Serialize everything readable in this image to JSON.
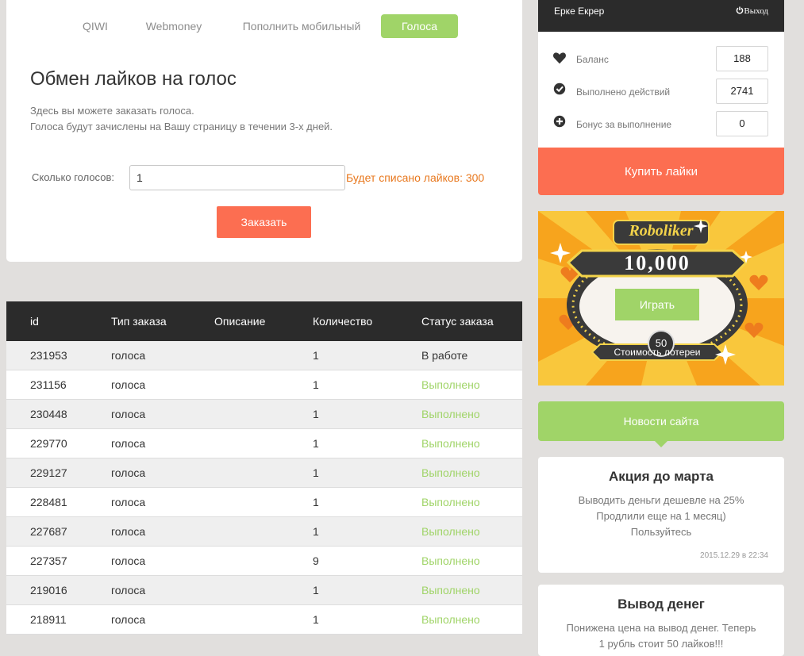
{
  "tabs": [
    {
      "label": "QIWI",
      "active": false
    },
    {
      "label": "Webmoney",
      "active": false
    },
    {
      "label": "Пополнить мобильный",
      "active": false
    },
    {
      "label": "Голоса",
      "active": true
    }
  ],
  "page": {
    "title": "Обмен лайков на голос",
    "desc_line1": "Здесь вы можете заказать голоса.",
    "desc_line2": "Голоса будут зачислены на Вашу страницу в течении 3-х дней."
  },
  "form": {
    "label": "Сколько голосов:",
    "value": "1",
    "cost_note": "Будет списано лайков: 300",
    "submit": "Заказать"
  },
  "table": {
    "headers": [
      "id",
      "Тип заказа",
      "Описание",
      "Количество",
      "Статус заказа"
    ],
    "rows": [
      {
        "id": "231953",
        "type": "голоса",
        "desc": "",
        "qty": "1",
        "status": "В работе"
      },
      {
        "id": "231156",
        "type": "голоса",
        "desc": "",
        "qty": "1",
        "status": "Выполнено"
      },
      {
        "id": "230448",
        "type": "голоса",
        "desc": "",
        "qty": "1",
        "status": "Выполнено"
      },
      {
        "id": "229770",
        "type": "голоса",
        "desc": "",
        "qty": "1",
        "status": "Выполнено"
      },
      {
        "id": "229127",
        "type": "голоса",
        "desc": "",
        "qty": "1",
        "status": "Выполнено"
      },
      {
        "id": "228481",
        "type": "голоса",
        "desc": "",
        "qty": "1",
        "status": "Выполнено"
      },
      {
        "id": "227687",
        "type": "голоса",
        "desc": "",
        "qty": "1",
        "status": "Выполнено"
      },
      {
        "id": "227357",
        "type": "голоса",
        "desc": "",
        "qty": "9",
        "status": "Выполнено"
      },
      {
        "id": "219016",
        "type": "голоса",
        "desc": "",
        "qty": "1",
        "status": "Выполнено"
      },
      {
        "id": "218911",
        "type": "голоса",
        "desc": "",
        "qty": "1",
        "status": "Выполнено"
      }
    ]
  },
  "user": {
    "name": "Ерке Екрер",
    "logout": "Выход"
  },
  "stats": [
    {
      "label": "Баланс",
      "value": "188",
      "icon": "heart-icon"
    },
    {
      "label": "Выполнено действий",
      "value": "2741",
      "icon": "check-circle-icon"
    },
    {
      "label": "Бонус за выполнение",
      "value": "0",
      "icon": "plus-circle-icon"
    }
  ],
  "buy_label": "Купить лайки",
  "banner": {
    "brand": "Roboliker",
    "amount": "10,000",
    "play": "Играть",
    "cost": "50",
    "cost_label": "Стоимость лотереи"
  },
  "news": {
    "heading": "Новости сайта",
    "items": [
      {
        "title": "Акция до марта",
        "line1": "Выводить деньги дешевле на 25%",
        "line2": "Продлили еще на 1 месяц)",
        "line3": "Пользуйтесь",
        "date": "2015.12.29 в 22:34"
      },
      {
        "title": "Вывод денег",
        "line1": "Понижена цена на вывод денег. Теперь",
        "line2": "1 рубль стоит 50 лайков!!!"
      }
    ]
  },
  "colors": {
    "green": "#a0d468",
    "coral": "#fc6e51",
    "dark": "#2b2b2b",
    "orange_text": "#e8781e"
  }
}
